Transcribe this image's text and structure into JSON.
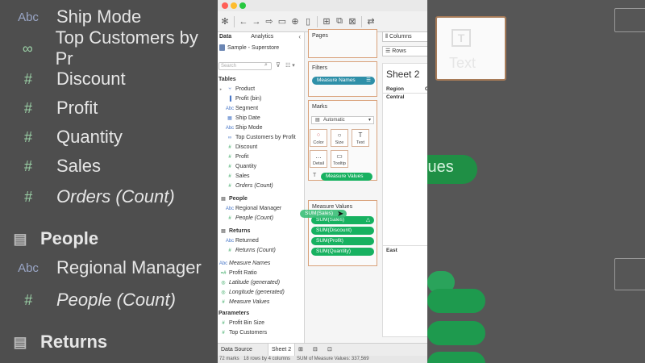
{
  "background_left": {
    "rows": [
      {
        "icon": "Abc",
        "label": "Ship Mode"
      },
      {
        "icon": "∞",
        "label": "Top Customers by Pr"
      },
      {
        "icon": "#",
        "label": "Discount"
      },
      {
        "icon": "#",
        "label": "Profit"
      },
      {
        "icon": "#",
        "label": "Quantity"
      },
      {
        "icon": "#",
        "label": "Sales"
      },
      {
        "icon": "#",
        "label": "Orders (Count)"
      },
      {
        "icon": "▤",
        "label": "People"
      },
      {
        "icon": "Abc",
        "label": "Regional Manager"
      },
      {
        "icon": "#",
        "label": "People (Count)"
      },
      {
        "icon": "▤",
        "label": "Returns"
      }
    ]
  },
  "background_right": {
    "text_label": "Text",
    "text_icon": "T",
    "pill_label": "lues"
  },
  "toolbar": {
    "icons": [
      "tableau-logo-icon",
      "back-icon",
      "forward-icon",
      "redo-icon",
      "save-icon",
      "new-datasource-icon",
      "pause-icon",
      "new-sheet-icon",
      "duplicate-icon",
      "clear-icon",
      "swap-icon",
      "sort-icon",
      "group-icon"
    ]
  },
  "data_pane": {
    "tab_data": "Data",
    "tab_analytics": "Analytics",
    "collapse": "‹",
    "source": "Sample - Superstore",
    "search_placeholder": "Search",
    "tables_header": "Tables",
    "items": [
      {
        "icon": "⑂",
        "label": "Product",
        "type": "dim",
        "caret": "▸"
      },
      {
        "icon": "▐",
        "label": "Profit (bin)",
        "type": "dim",
        "caret": ""
      },
      {
        "icon": "Abc",
        "label": "Segment",
        "type": "dim",
        "caret": ""
      },
      {
        "icon": "▦",
        "label": "Ship Date",
        "type": "dim",
        "caret": ""
      },
      {
        "icon": "Abc",
        "label": "Ship Mode",
        "type": "dim",
        "caret": ""
      },
      {
        "icon": "∞",
        "label": "Top Customers by Profit",
        "type": "dim",
        "caret": ""
      },
      {
        "icon": "#",
        "label": "Discount",
        "type": "meas",
        "caret": ""
      },
      {
        "icon": "#",
        "label": "Profit",
        "type": "meas",
        "caret": ""
      },
      {
        "icon": "#",
        "label": "Quantity",
        "type": "meas",
        "caret": ""
      },
      {
        "icon": "#",
        "label": "Sales",
        "type": "meas",
        "caret": ""
      },
      {
        "icon": "#",
        "label": "Orders (Count)",
        "type": "meas",
        "caret": "",
        "italic": true
      }
    ],
    "people_header": "People",
    "people_items": [
      {
        "icon": "Abc",
        "label": "Regional Manager",
        "type": "dim"
      },
      {
        "icon": "#",
        "label": "People (Count)",
        "type": "meas",
        "italic": true
      }
    ],
    "returns_header": "Returns",
    "returns_items": [
      {
        "icon": "Abc",
        "label": "Returned",
        "type": "dim"
      },
      {
        "icon": "#",
        "label": "Returns (Count)",
        "type": "meas",
        "italic": true
      }
    ],
    "other_items": [
      {
        "icon": "Abc",
        "label": "Measure Names",
        "type": "dim",
        "italic": true
      },
      {
        "icon": "=#",
        "label": "Profit Ratio",
        "type": "meas"
      },
      {
        "icon": "◎",
        "label": "Latitude (generated)",
        "type": "meas",
        "italic": true
      },
      {
        "icon": "◎",
        "label": "Longitude (generated)",
        "type": "meas",
        "italic": true
      },
      {
        "icon": "#",
        "label": "Measure Values",
        "type": "meas",
        "italic": true
      }
    ],
    "parameters_header": "Parameters",
    "parameters_items": [
      {
        "icon": "#",
        "label": "Profit Bin Size",
        "type": "meas"
      },
      {
        "icon": "#",
        "label": "Top Customers",
        "type": "meas"
      }
    ]
  },
  "shelves": {
    "pages_title": "Pages",
    "filters_title": "Filters",
    "filter_pill": "Measure Names",
    "marks_title": "Marks",
    "marks_type": "Automatic",
    "mark_buttons": [
      {
        "glyph": "⁘",
        "label": "Color"
      },
      {
        "glyph": "○",
        "label": "Size"
      },
      {
        "glyph": "T",
        "label": "Text"
      },
      {
        "glyph": "…",
        "label": "Detail"
      },
      {
        "glyph": "▭",
        "label": "Tooltip"
      }
    ],
    "marks_pill": "Measure Values",
    "measure_values_title": "Measure Values",
    "measure_pills": [
      "SUM(Sales)",
      "SUM(Discount)",
      "SUM(Profit)",
      "SUM(Quantity)"
    ],
    "dragging_pill": "SUM(Sales)"
  },
  "canvas": {
    "columns_label": "Columns",
    "rows_label": "Rows",
    "sheet_title": "Sheet 2",
    "header_region": "Region",
    "header_c": "C",
    "cell_central": "Central",
    "cell_east": "East"
  },
  "bottom": {
    "tab_datasource": "Data Source",
    "tab_sheet": "Sheet 2",
    "status_marks": "72 marks",
    "status_rows": "18 rows by 4 columns",
    "status_sum": "SUM of Measure Values: 337,569"
  },
  "colors": {
    "accent_teal": "#2e8fa8",
    "measure_green": "#17b160",
    "card_border": "#d9a17a"
  }
}
